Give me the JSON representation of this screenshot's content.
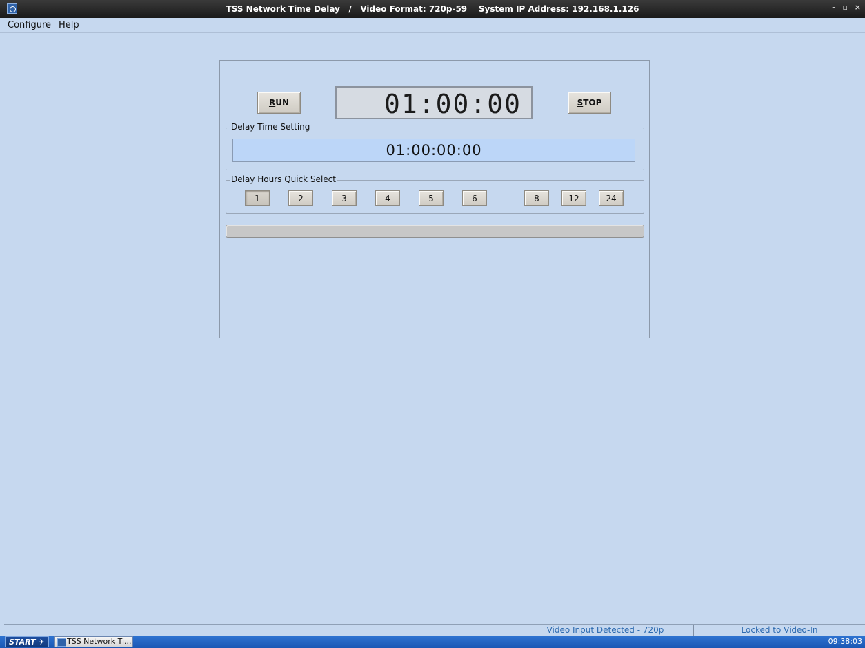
{
  "window": {
    "title": "TSS Network Time Delay   /   Video Format: 720p-59    System IP Address: 192.168.1.126",
    "controls": [
      "–",
      "▫",
      "×"
    ]
  },
  "menu": {
    "items": [
      "Configure",
      "Help"
    ]
  },
  "controls": {
    "run_label_underlined": "R",
    "run_label_rest": "UN",
    "stop_label_underlined": "S",
    "stop_label_rest": "TOP",
    "timer_display": "01:00:00"
  },
  "delay_time": {
    "legend": "Delay Time Setting",
    "value": "01:00:00:00"
  },
  "quick_select": {
    "legend": "Delay Hours Quick Select",
    "buttons": [
      "1",
      "2",
      "3",
      "4",
      "5",
      "6",
      "8",
      "12",
      "24"
    ],
    "selected": "1"
  },
  "progress": {
    "value": 0
  },
  "statusbar": {
    "video_input": "Video Input Detected - 720p",
    "lock_status": "Locked to Video-In"
  },
  "taskbar": {
    "start_label": "START",
    "task_label": "TSS Network Ti...",
    "clock": "09:38:03"
  },
  "colors": {
    "background": "#c6d8ef",
    "field_bg": "#bcd6f8",
    "taskbar": "#1f5fbf",
    "status_text": "#2e6bb0"
  }
}
